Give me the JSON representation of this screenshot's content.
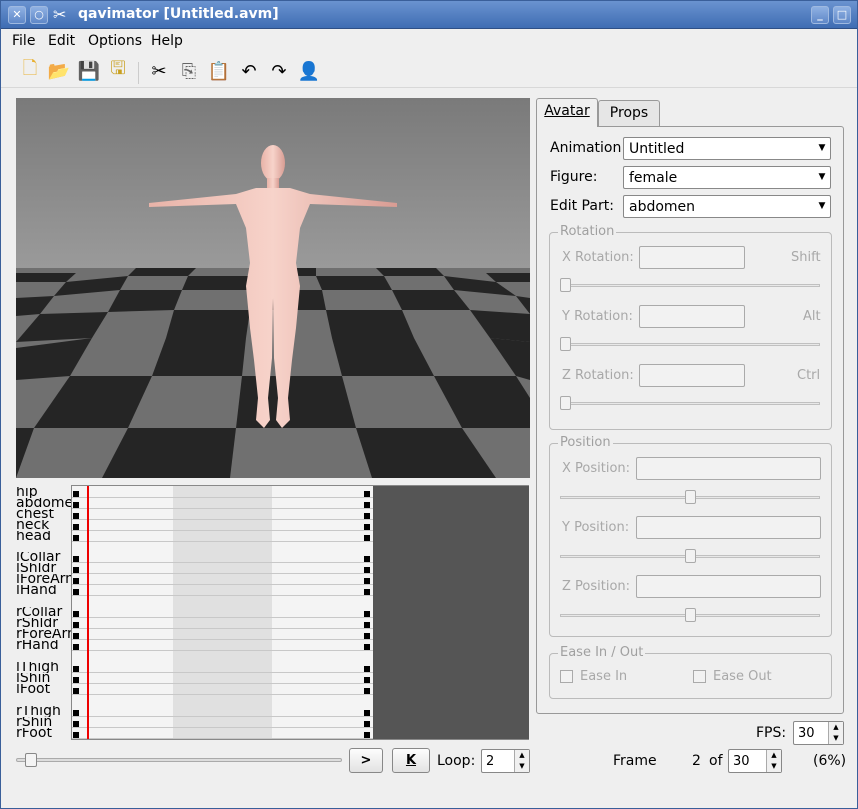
{
  "window": {
    "title": "qavimator [Untitled.avm]"
  },
  "menu": [
    "File",
    "Edit",
    "Options",
    "Help"
  ],
  "toolbar": {
    "icons": [
      "new-icon",
      "open-icon",
      "save-icon",
      "save-as-icon",
      "cut-icon",
      "copy-icon",
      "paste-icon",
      "undo-icon",
      "redo-icon",
      "skeleton-icon"
    ]
  },
  "timeline": {
    "joints": [
      "hip",
      "abdomen",
      "chest",
      "neck",
      "head",
      "lCollar",
      "lShldr",
      "lForeArm",
      "lHand",
      "rCollar",
      "rShldr",
      "rForeArm",
      "rHand",
      "lThigh",
      "lShin",
      "lFoot",
      "rThigh",
      "rShin",
      "rFoot"
    ]
  },
  "playback": {
    "play_label": ">",
    "key_label": "K",
    "loop_label": "Loop:",
    "loop_value": "2",
    "position_fraction": 0.03
  },
  "tabs": {
    "avatar": "Avatar",
    "props": "Props"
  },
  "avatar": {
    "animation_label": "Animation:",
    "animation_value": "Untitled",
    "figure_label": "Figure:",
    "figure_value": "female",
    "editpart_label": "Edit Part:",
    "editpart_value": "abdomen",
    "rotation": {
      "title": "Rotation",
      "x_label": "X Rotation:",
      "x_mod": "Shift",
      "y_label": "Y Rotation:",
      "y_mod": "Alt",
      "z_label": "Z Rotation:",
      "z_mod": "Ctrl"
    },
    "position": {
      "title": "Position",
      "x_label": "X Position:",
      "y_label": "Y Position:",
      "z_label": "Z Position:"
    },
    "ease": {
      "title": "Ease In / Out",
      "ease_in": "Ease In",
      "ease_out": "Ease Out"
    }
  },
  "fps": {
    "label": "FPS:",
    "value": "30"
  },
  "frame": {
    "label": "Frame",
    "current": "2",
    "of_label": "of",
    "total": "30",
    "percent": "(6%)"
  }
}
